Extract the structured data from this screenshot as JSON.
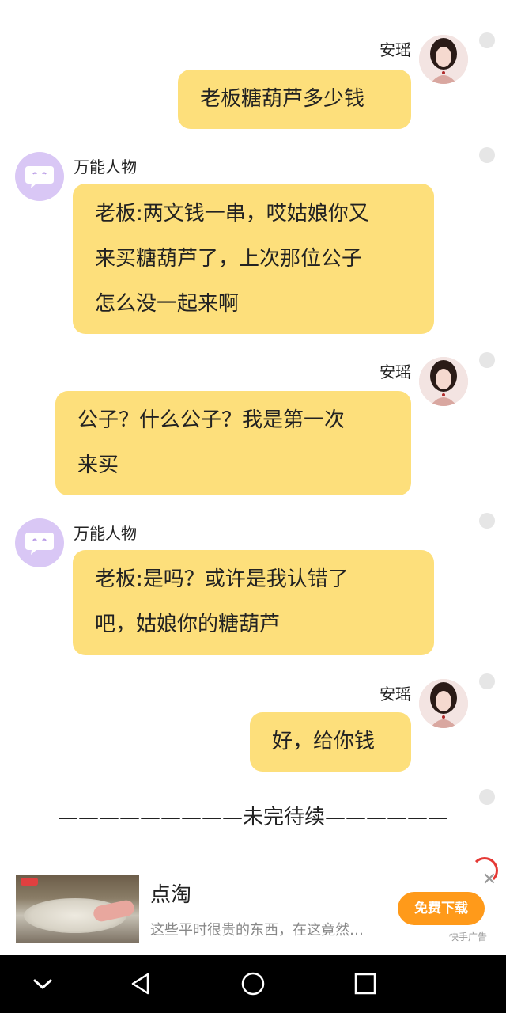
{
  "messages": [
    {
      "sender": "安瑶",
      "side": "right",
      "lines": [
        "老板糖葫芦多少钱"
      ]
    },
    {
      "sender": "万能人物",
      "side": "left",
      "lines": [
        "老板:两文钱一串，哎姑娘你又",
        "来买糖葫芦了，上次那位公子",
        "怎么没一起来啊"
      ]
    },
    {
      "sender": "安瑶",
      "side": "right",
      "lines": [
        "公子？什么公子？我是第一次",
        "来买"
      ]
    },
    {
      "sender": "万能人物",
      "side": "left",
      "lines": [
        "老板:是吗？或许是我认错了",
        "吧，姑娘你的糖葫芦"
      ]
    },
    {
      "sender": "安瑶",
      "side": "right",
      "lines": [
        "好，给你钱"
      ]
    }
  ],
  "divider_text": "—————————未完待续——————",
  "ad": {
    "title": "点淘",
    "description": "这些平时很贵的东西，在这竟然…",
    "button_label": "免费下载",
    "label": "快手广告"
  },
  "icons": {
    "close": "close-icon",
    "back": "nav-back-icon",
    "home": "nav-home-icon",
    "recents": "nav-recents-icon",
    "collapse": "nav-collapse-icon"
  },
  "colors": {
    "bubble": "#fddf7b",
    "ad_button": "#ff9a1a",
    "bot_avatar": "#d9c7f5"
  }
}
